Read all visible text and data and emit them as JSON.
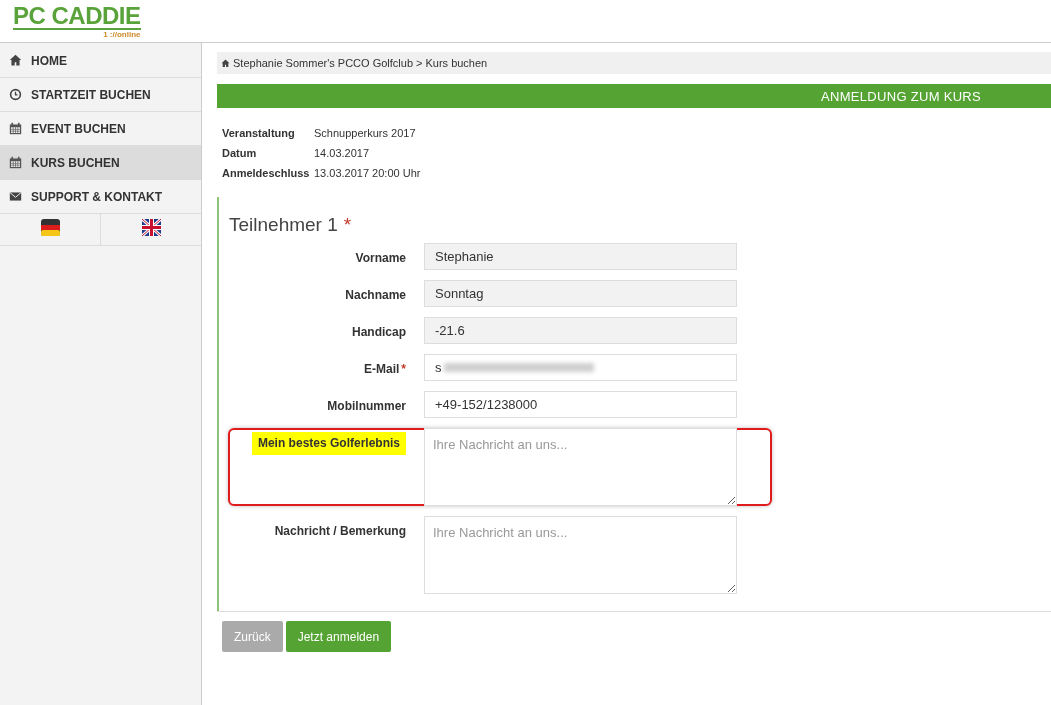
{
  "logo": {
    "title": "PC CADDIE",
    "subtitle": "1 ://online"
  },
  "sidebar": {
    "items": [
      {
        "label": "HOME",
        "selected": false
      },
      {
        "label": "STARTZEIT BUCHEN",
        "selected": false
      },
      {
        "label": "EVENT BUCHEN",
        "selected": false
      },
      {
        "label": "KURS BUCHEN",
        "selected": true
      },
      {
        "label": "SUPPORT & KONTAKT",
        "selected": false
      }
    ]
  },
  "breadcrumb": {
    "items": [
      "Stephanie Sommer's PCCO Golfclub",
      "Kurs buchen"
    ],
    "separator": ">"
  },
  "banner": {
    "title": "ANMELDUNG ZUM KURS"
  },
  "details": [
    {
      "label": "Veranstaltung",
      "value": "Schnupperkurs 2017"
    },
    {
      "label": "Datum",
      "value": "14.03.2017"
    },
    {
      "label": "Anmeldeschluss",
      "value": "13.03.2017 20:00 Uhr"
    }
  ],
  "participant": {
    "title": "Teilnehmer 1",
    "required_mark": "*",
    "fields": [
      {
        "kind": "input",
        "label": "Vorname",
        "value": "Stephanie",
        "disabled": true
      },
      {
        "kind": "input",
        "label": "Nachname",
        "value": "Sonntag",
        "disabled": true
      },
      {
        "kind": "input",
        "label": "Handicap",
        "value": "-21.6",
        "disabled": true
      },
      {
        "kind": "input",
        "label": "E-Mail",
        "required_mark": "*",
        "value": "s",
        "blurred": true,
        "disabled": false
      },
      {
        "kind": "input",
        "label": "Mobilnummer",
        "value": "+49-152/1238000",
        "disabled": false
      },
      {
        "kind": "textarea",
        "label": "Mein bestes Golferlebnis",
        "placeholder": "Ihre Nachricht an uns...",
        "highlighted": true,
        "outlined": true
      },
      {
        "kind": "textarea",
        "label": "Nachricht / Bemerkung",
        "placeholder": "Ihre Nachricht an uns...",
        "highlighted": false,
        "outlined": false
      }
    ]
  },
  "buttons": [
    {
      "label": "Zurück",
      "kind": "secondary"
    },
    {
      "label": "Jetzt anmelden",
      "kind": "primary"
    }
  ]
}
